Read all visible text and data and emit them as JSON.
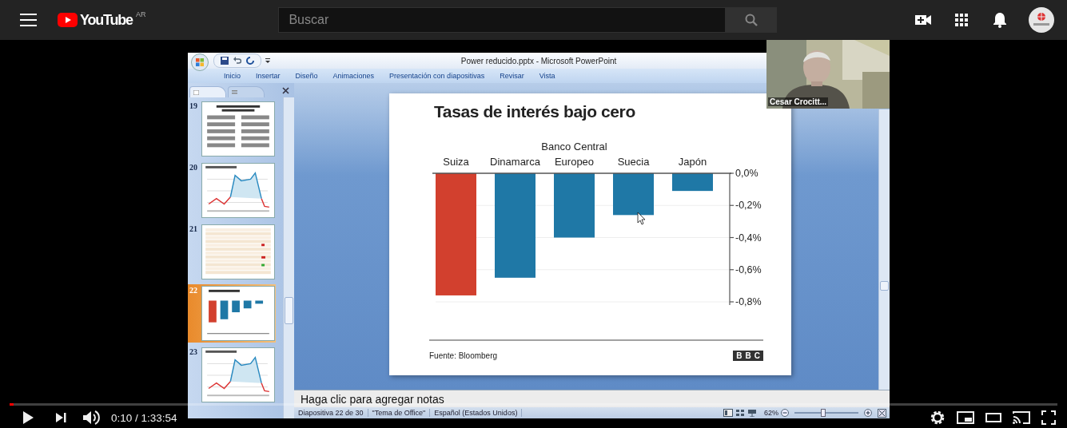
{
  "topbar": {
    "logo": "YouTube",
    "region": "AR",
    "search": {
      "placeholder": "Buscar"
    }
  },
  "video": {
    "powerpoint": {
      "title": "Power reducido.pptx - Microsoft PowerPoint",
      "ribbon_tabs": [
        "Inicio",
        "Insertar",
        "Diseño",
        "Animaciones",
        "Presentación con diapositivas",
        "Revisar",
        "Vista"
      ],
      "slides": [
        {
          "number": "19",
          "kind": "text",
          "selected": false
        },
        {
          "number": "20",
          "kind": "line",
          "selected": false
        },
        {
          "number": "21",
          "kind": "table",
          "selected": false
        },
        {
          "number": "22",
          "kind": "bars",
          "selected": true
        },
        {
          "number": "23",
          "kind": "line",
          "selected": false
        }
      ],
      "slide": {
        "title": "Tasas de interés bajo cero",
        "chart_data": {
          "type": "bar",
          "categories": [
            "Suiza",
            "Dinamarca",
            "Banco Central Europeo",
            "Suecia",
            "Japón"
          ],
          "series": [
            {
              "color": "#d2402e",
              "values": [
                -0.76,
                null,
                null,
                null,
                null
              ]
            },
            {
              "color": "#1f78a6",
              "values": [
                null,
                -0.65,
                -0.4,
                -0.26,
                -0.11
              ]
            }
          ],
          "stacked": true,
          "grid": true,
          "ylim": [
            -0.8,
            0
          ],
          "yticks": [
            {
              "value": 0,
              "label": "0,0%"
            },
            {
              "value": -0.2,
              "label": "-0,2%"
            },
            {
              "value": -0.4,
              "label": "-0,4%"
            },
            {
              "value": -0.6,
              "label": "-0,6%"
            },
            {
              "value": -0.8,
              "label": "-0,8%"
            }
          ]
        },
        "source": "Fuente: Bloomberg",
        "logo": "BBC"
      },
      "notes": "Haga clic para agregar notas",
      "status_bar": {
        "slide": "Diapositiva 22 de 30",
        "theme": "\"Tema de Office\"",
        "language": "Español (Estados Unidos)",
        "zoom": "62%",
        "zoom_slider": {
          "level": 0.45
        }
      }
    },
    "participant": {
      "name": "Cesar Crocitt..."
    }
  },
  "player": {
    "progress": {
      "level": 0.004
    },
    "time": "0:10 / 1:33:54"
  }
}
